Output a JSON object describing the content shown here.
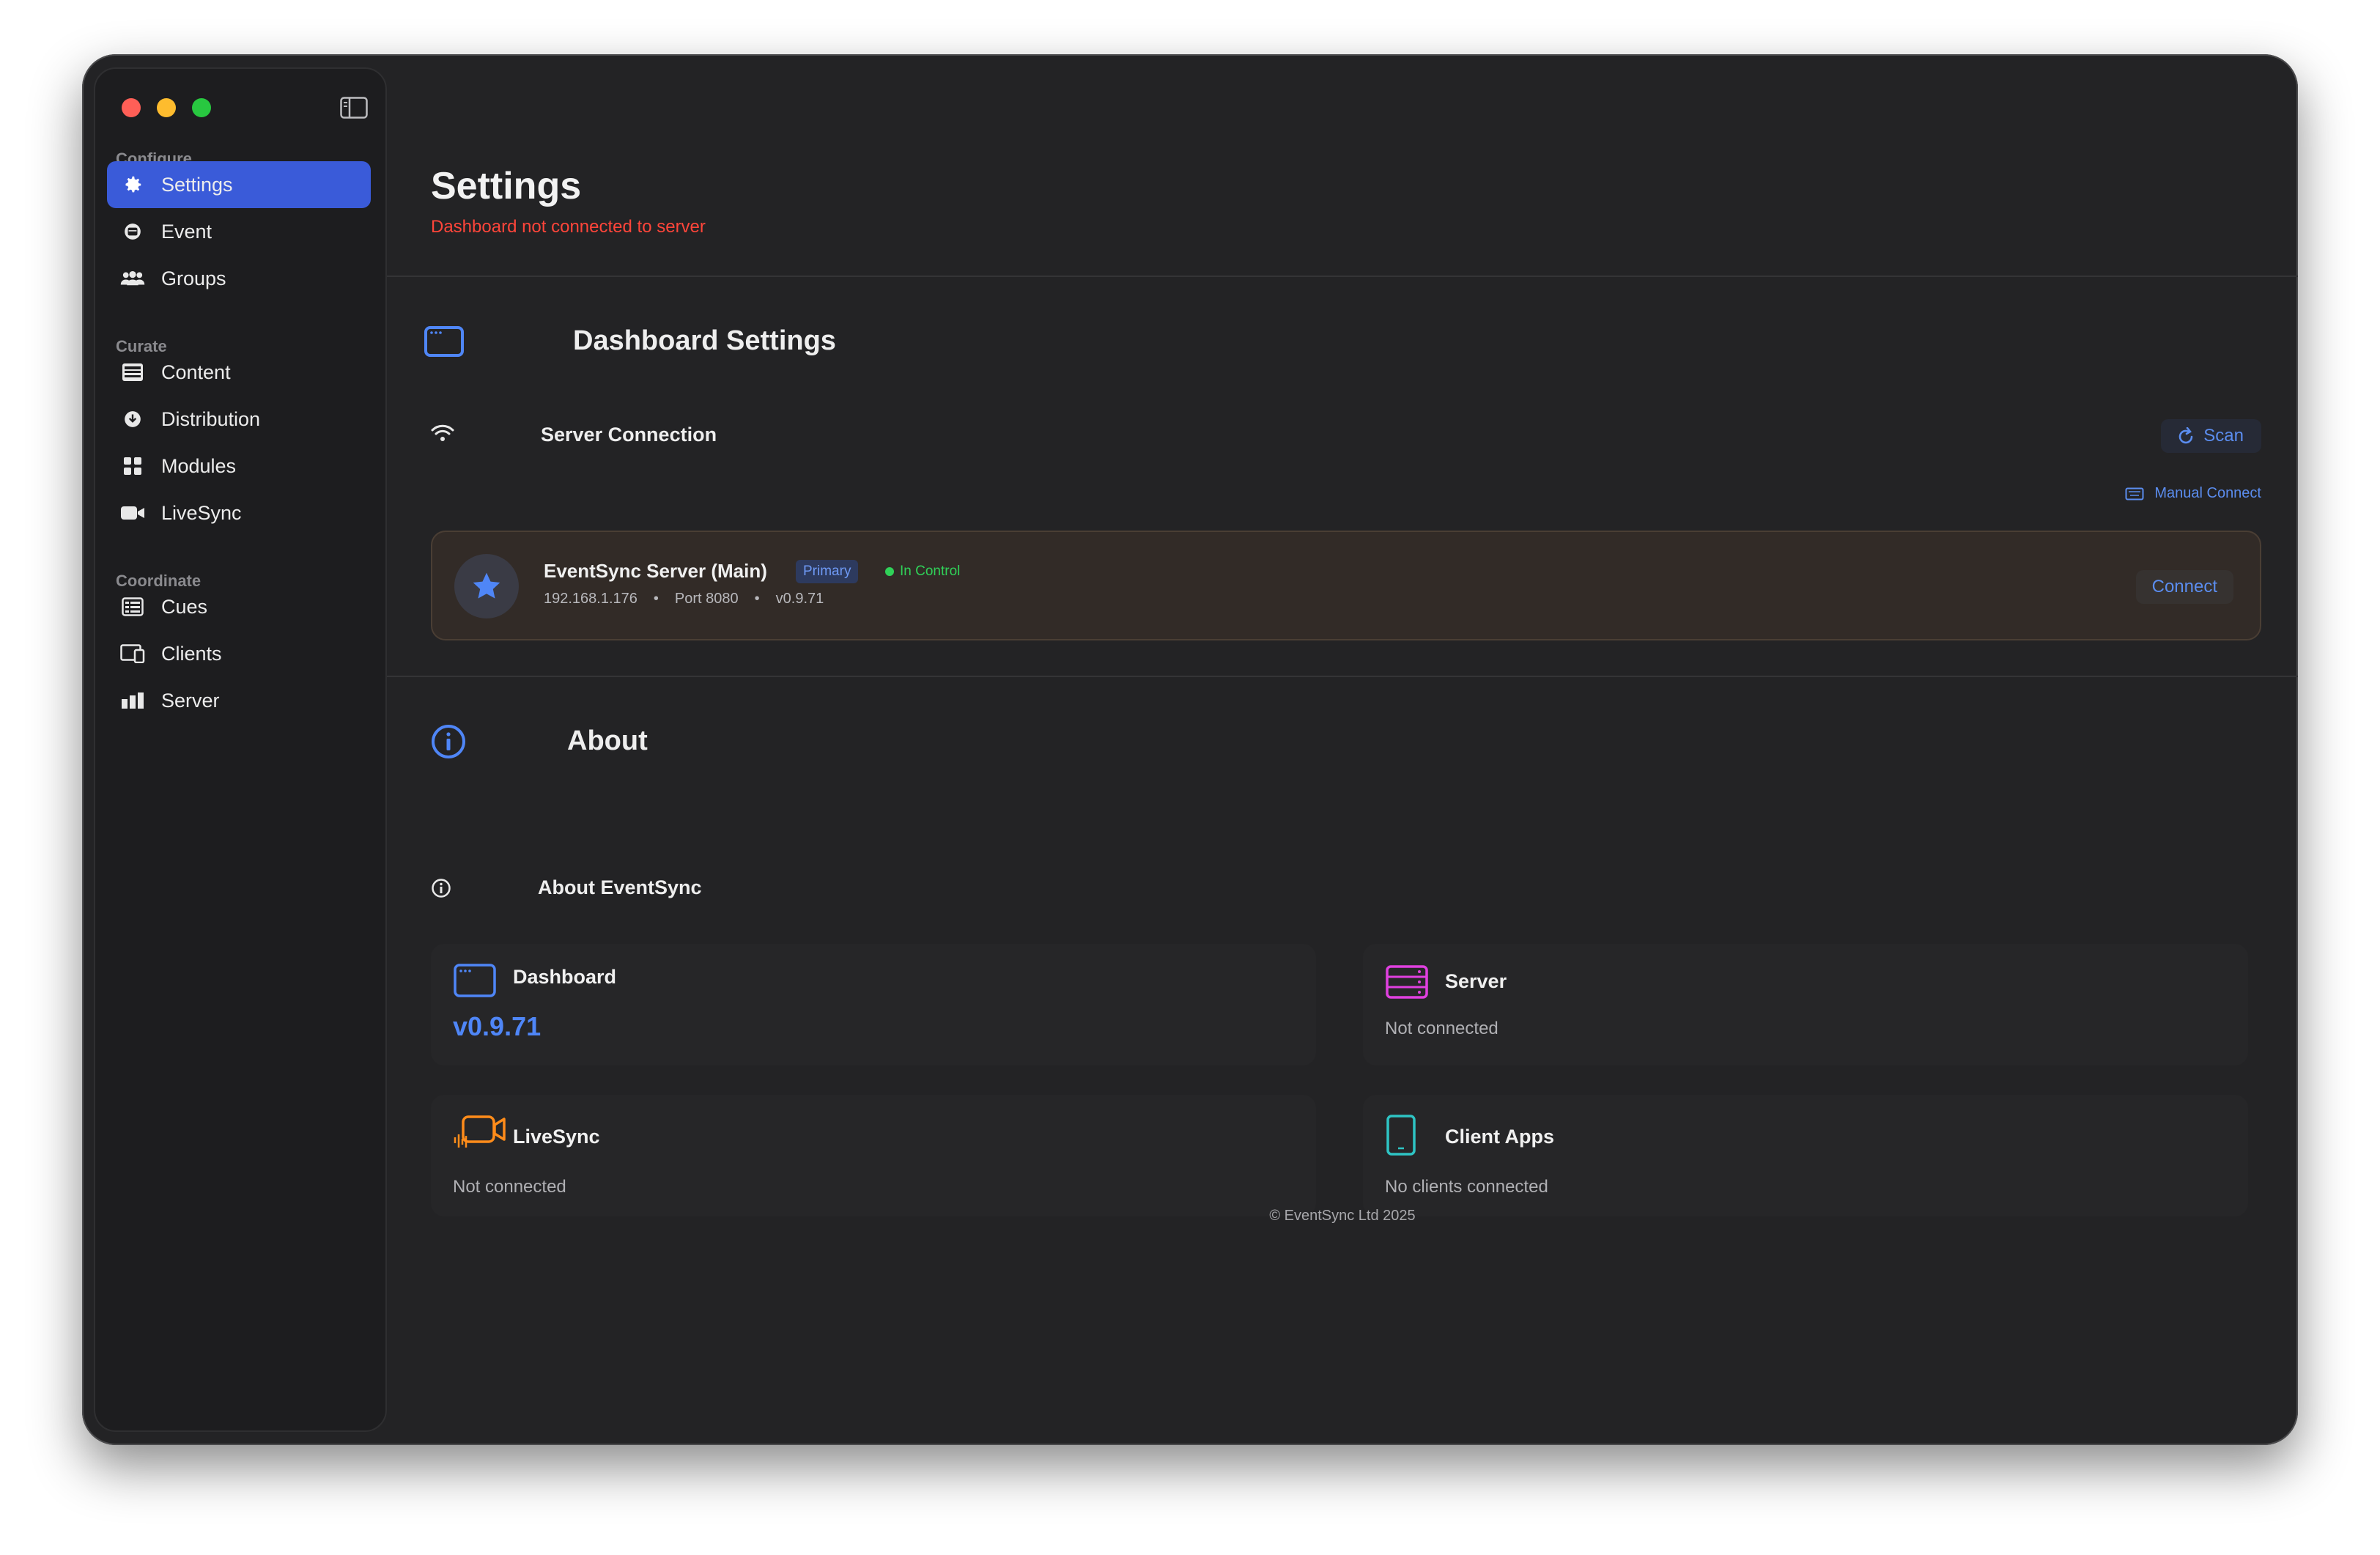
{
  "sidebar": {
    "sections": [
      {
        "label": "Configure",
        "items": [
          {
            "label": "Settings",
            "icon": "gear-icon",
            "active": true
          },
          {
            "label": "Event",
            "icon": "event-icon"
          },
          {
            "label": "Groups",
            "icon": "groups-icon"
          }
        ]
      },
      {
        "label": "Curate",
        "items": [
          {
            "label": "Content",
            "icon": "content-icon"
          },
          {
            "label": "Distribution",
            "icon": "distribution-icon"
          },
          {
            "label": "Modules",
            "icon": "modules-icon"
          },
          {
            "label": "LiveSync",
            "icon": "video-camera-icon"
          }
        ]
      },
      {
        "label": "Coordinate",
        "items": [
          {
            "label": "Cues",
            "icon": "cues-icon"
          },
          {
            "label": "Clients",
            "icon": "clients-icon"
          },
          {
            "label": "Server",
            "icon": "server-bars-icon"
          }
        ]
      }
    ]
  },
  "header": {
    "title": "Settings",
    "subtitle": "Dashboard not connected to server"
  },
  "dashboard_settings": {
    "title": "Dashboard Settings",
    "server_connection": {
      "title": "Server Connection",
      "scan_label": "Scan",
      "manual_connect_label": "Manual Connect",
      "server": {
        "name": "EventSync Server (Main)",
        "primary_badge": "Primary",
        "control_status": "In Control",
        "ip": "192.168.1.176",
        "port": "Port 8080",
        "version": "v0.9.71",
        "separator": "•",
        "connect_label": "Connect"
      }
    }
  },
  "about": {
    "title": "About",
    "subtitle": "About EventSync",
    "cards": {
      "dashboard": {
        "title": "Dashboard",
        "version": "v0.9.71"
      },
      "server": {
        "title": "Server",
        "status": "Not connected"
      },
      "livesync": {
        "title": "LiveSync",
        "status": "Not connected"
      },
      "client_apps": {
        "title": "Client Apps",
        "status": "No clients connected"
      }
    },
    "footer": "© EventSync Ltd 2025"
  },
  "colors": {
    "accent": "#3a5bd9",
    "link": "#5b8def",
    "error": "#ff453a",
    "success": "#30d158",
    "server_icon": "#e040e0",
    "livesync_icon": "#ff8c1a",
    "client_icon": "#2ec4c4"
  }
}
